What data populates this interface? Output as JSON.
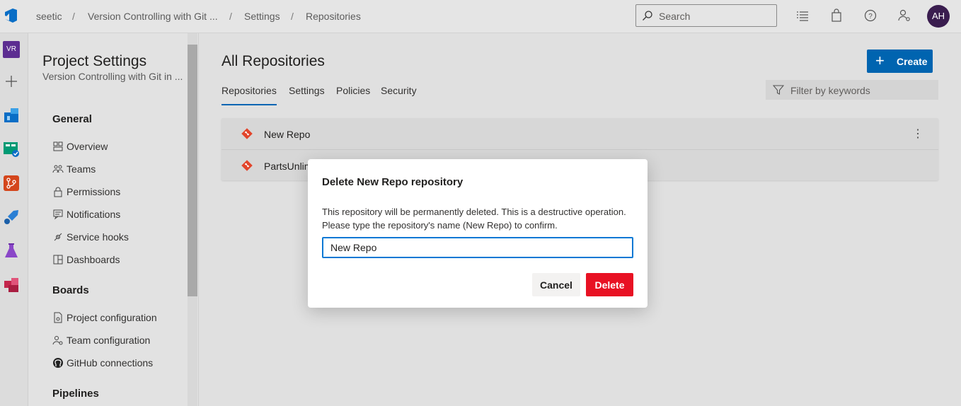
{
  "breadcrumb": {
    "org": "seetic",
    "project": "Version Controlling with Git ...",
    "settings": "Settings",
    "page": "Repositories"
  },
  "search": {
    "placeholder": "Search"
  },
  "user": {
    "initials": "AH"
  },
  "rail": {
    "project_badge": "VR",
    "items": [
      "azure-devops-logo",
      "project-badge",
      "plus-icon",
      "overview-icon",
      "boards-icon",
      "repos-icon",
      "pipelines-icon",
      "test-plans-icon",
      "artifacts-icon"
    ]
  },
  "sidebar": {
    "title": "Project Settings",
    "subtitle": "Version Controlling with Git in ...",
    "sections": [
      {
        "heading": "General",
        "items": [
          "Overview",
          "Teams",
          "Permissions",
          "Notifications",
          "Service hooks",
          "Dashboards"
        ]
      },
      {
        "heading": "Boards",
        "items": [
          "Project configuration",
          "Team configuration",
          "GitHub connections"
        ]
      },
      {
        "heading": "Pipelines",
        "items": []
      }
    ]
  },
  "main": {
    "title": "All Repositories",
    "create_label": "Create",
    "filter_placeholder": "Filter by keywords",
    "tabs": [
      "Repositories",
      "Settings",
      "Policies",
      "Security"
    ],
    "active_tab": "Repositories",
    "repos": [
      "New Repo",
      "PartsUnlim"
    ]
  },
  "dialog": {
    "title": "Delete New Repo repository",
    "description": "This repository will be permanently deleted. This is a destructive operation. Please type the repository's name (New Repo) to confirm.",
    "input_value": "New Repo",
    "cancel_label": "Cancel",
    "delete_label": "Delete"
  },
  "colors": {
    "accent": "#0064b0",
    "danger": "#e81123",
    "git_icon": "#e2452b",
    "avatar": "#3a1d4f"
  }
}
